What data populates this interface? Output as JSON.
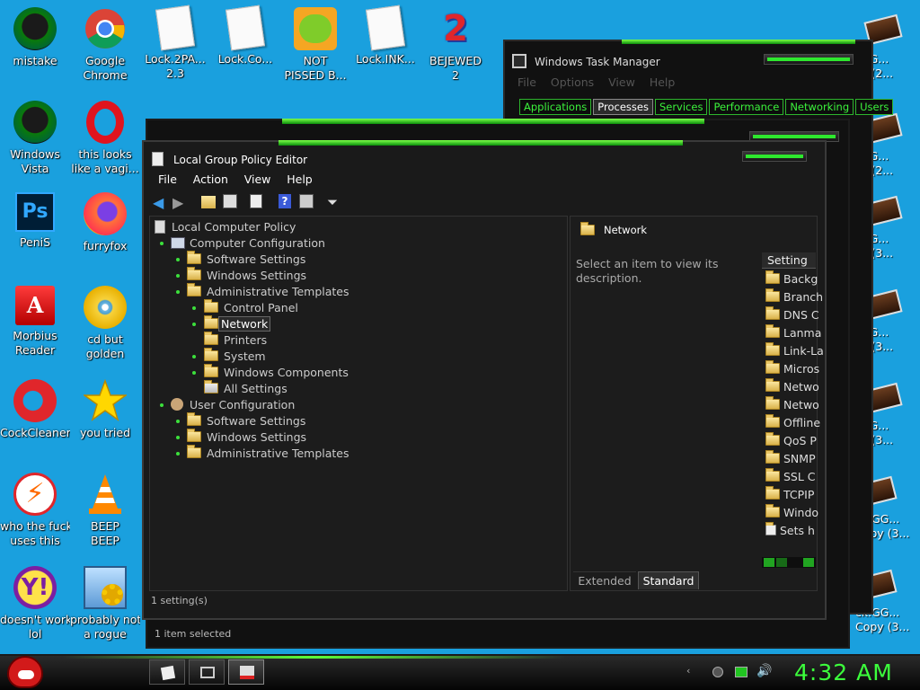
{
  "desktop": {
    "icons": [
      {
        "label1": "mistake",
        "label2": ""
      },
      {
        "label1": "Google",
        "label2": "Chrome"
      },
      {
        "label1": "Lock.2PA...",
        "label2": "2.3"
      },
      {
        "label1": "Lock.Co...",
        "label2": ""
      },
      {
        "label1": "NOT",
        "label2": "PISSED B..."
      },
      {
        "label1": "Lock.INK...",
        "label2": ""
      },
      {
        "label1": "BEJEWED",
        "label2": "2"
      },
      {
        "label1": "Windows",
        "label2": "Vista"
      },
      {
        "label1": "this looks",
        "label2": "like a vagi..."
      },
      {
        "label1": "PeniS",
        "label2": ""
      },
      {
        "label1": "furryfox",
        "label2": ""
      },
      {
        "label1": "Morbius",
        "label2": "Reader"
      },
      {
        "label1": "cd but",
        "label2": "golden"
      },
      {
        "label1": "CockCleaner",
        "label2": ""
      },
      {
        "label1": "you tried",
        "label2": ""
      },
      {
        "label1": "who the fuck",
        "label2": "uses this"
      },
      {
        "label1": "BEEP",
        "label2": "BEEP"
      },
      {
        "label1": "doesn't work",
        "label2": "lol"
      },
      {
        "label1": "probably not",
        "label2": "a rogue"
      }
    ],
    "right_icons": [
      {
        "l1": "GG...",
        "l2": "y (2..."
      },
      {
        "l1": "GG...",
        "l2": "y (2..."
      },
      {
        "l1": "GG...",
        "l2": "y (3..."
      },
      {
        "l1": "GG...",
        "l2": "y (3..."
      },
      {
        "l1": "GG...",
        "l2": "y (3..."
      },
      {
        "l1": "ck.GG...",
        "l2": "Copy (3..."
      },
      {
        "l1": "ck.GG...",
        "l2": "Copy (3..."
      }
    ]
  },
  "task_manager": {
    "title": "Windows Task Manager",
    "menu": [
      "File",
      "Options",
      "View",
      "Help"
    ],
    "tabs": [
      "Applications",
      "Processes",
      "Services",
      "Performance",
      "Networking",
      "Users"
    ]
  },
  "gpe": {
    "title": "Local Group Policy Editor",
    "menu": [
      "File",
      "Action",
      "View",
      "Help"
    ],
    "tree": [
      {
        "label": "Local Computer Policy"
      },
      {
        "label": "Computer Configuration"
      },
      {
        "label": "Software Settings"
      },
      {
        "label": "Windows Settings"
      },
      {
        "label": "Administrative Templates"
      },
      {
        "label": "Control Panel"
      },
      {
        "label": "Network"
      },
      {
        "label": "Printers"
      },
      {
        "label": "System"
      },
      {
        "label": "Windows Components"
      },
      {
        "label": "All Settings"
      },
      {
        "label": "User Configuration"
      },
      {
        "label": "Software Settings"
      },
      {
        "label": "Windows Settings"
      },
      {
        "label": "Administrative Templates"
      }
    ],
    "details_header": "Network",
    "description": "Select an item to view its description.",
    "column_setting": "Setting",
    "settings_list": [
      "Backg",
      "Branch",
      "DNS C",
      "Lanma",
      "Link-La",
      "Micros",
      "Netwo",
      "Netwo",
      "Offline",
      "QoS P",
      "SNMP",
      "SSL C",
      "TCPIP",
      "Windo",
      "Sets h"
    ],
    "bottom_tabs": [
      "Extended",
      "Standard"
    ],
    "status_inner": "1 setting(s)",
    "status_outer": "1 item selected"
  },
  "taskbar": {
    "clock": "4:32 AM"
  }
}
